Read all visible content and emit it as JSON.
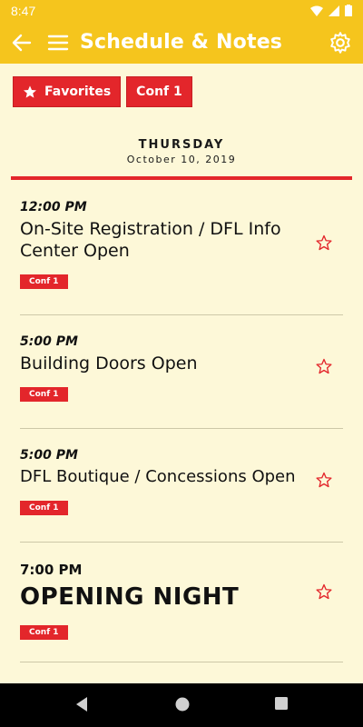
{
  "status": {
    "time": "8:47"
  },
  "appbar": {
    "title": "Schedule & Notes"
  },
  "filters": {
    "favorites_label": "Favorites",
    "conf_label": "Conf 1"
  },
  "day": {
    "weekday": "THURSDAY",
    "date": "October 10, 2019"
  },
  "events": [
    {
      "time": "12:00 PM",
      "name": "On-Site Registration / DFL Info Center Open",
      "tag": "Conf 1"
    },
    {
      "time": "5:00 PM",
      "name": "Building Doors Open",
      "tag": "Conf 1"
    },
    {
      "time": "5:00 PM",
      "name": "DFL Boutique / Concessions Open",
      "tag": "Conf 1"
    },
    {
      "time": "7:00 PM",
      "name": "OPENING NIGHT",
      "tag": "Conf 1"
    }
  ],
  "colors": {
    "accent": "#f5c51d",
    "red": "#e3262b",
    "background": "#fdf8d8"
  }
}
